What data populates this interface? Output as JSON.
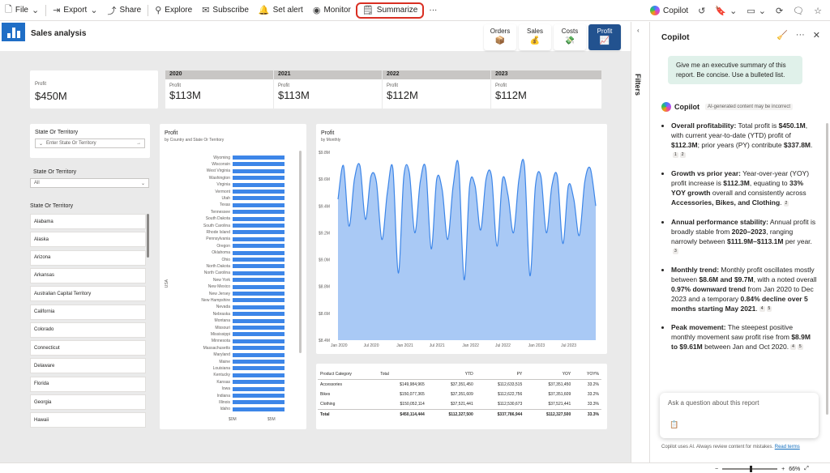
{
  "toolbar": {
    "file": "File",
    "export": "Export",
    "share": "Share",
    "explore": "Explore",
    "subscribe": "Subscribe",
    "set_alert": "Set alert",
    "monitor": "Monitor",
    "summarize": "Summarize",
    "more": "···",
    "copilot": "Copilot"
  },
  "report": {
    "title": "Sales analysis",
    "nav": [
      {
        "label": "Orders",
        "icon": "box-icon"
      },
      {
        "label": "Sales",
        "icon": "money-bag-icon"
      },
      {
        "label": "Costs",
        "icon": "cash-icon"
      },
      {
        "label": "Profit",
        "icon": "chart-up-icon"
      }
    ],
    "kpi": {
      "label": "Profit",
      "value": "$450M"
    },
    "years": [
      {
        "year": "2020",
        "label": "Profit",
        "value": "$113M"
      },
      {
        "year": "2021",
        "label": "Profit",
        "value": "$113M"
      },
      {
        "year": "2022",
        "label": "Profit",
        "value": "$112M"
      },
      {
        "year": "2023",
        "label": "Profit",
        "value": "$112M"
      }
    ],
    "slicer1": {
      "title": "State Or Territory",
      "placeholder": "Enter State Or Territory"
    },
    "slicer2": {
      "title": "State Or Territory",
      "value": "All"
    },
    "slicer3": {
      "title": "State Or Territory",
      "items": [
        "Alabama",
        "Alaska",
        "Arizona",
        "Arkansas",
        "Australian Capital Territory",
        "California",
        "Colorado",
        "Connecticut",
        "Delaware",
        "Florida",
        "Georgia",
        "Hawaii"
      ]
    },
    "bar_chart": {
      "title": "Profit",
      "subtitle": "by Country and State Or Territory",
      "axis_group": "USA",
      "x_ticks": [
        "$0M",
        "$5M"
      ],
      "states": [
        "Wyoming",
        "Wisconsin",
        "West Virginia",
        "Washington",
        "Virginia",
        "Vermont",
        "Utah",
        "Texas",
        "Tennessee",
        "South Dakota",
        "South Carolina",
        "Rhode Island",
        "Pennsylvania",
        "Oregon",
        "Oklahoma",
        "Ohio",
        "North Dakota",
        "North Carolina",
        "New York",
        "New Mexico",
        "New Jersey",
        "New Hampshire",
        "Nevada",
        "Nebraska",
        "Montana",
        "Missouri",
        "Mississippi",
        "Minnesota",
        "Massachusetts",
        "Maryland",
        "Maine",
        "Louisiana",
        "Kentucky",
        "Kansas",
        "Iowa",
        "Indiana",
        "Illinois",
        "Idaho"
      ]
    },
    "line_chart": {
      "title": "Profit",
      "subtitle": "by Monthly",
      "y_ticks": [
        "$9.8M",
        "$9.6M",
        "$9.4M",
        "$9.2M",
        "$9.0M",
        "$8.8M",
        "$8.6M",
        "$8.4M"
      ],
      "x_ticks": [
        "Jan 2020",
        "Jul 2020",
        "Jan 2021",
        "Jul 2021",
        "Jan 2022",
        "Jul 2022",
        "Jan 2023",
        "Jul 2023"
      ]
    },
    "table": {
      "headers": [
        "Product Category",
        "Total",
        "YTD",
        "PY",
        "YOY",
        "YOY%"
      ],
      "rows": [
        [
          "Accessories",
          "$149,984,965",
          "$37,351,450",
          "$112,633,515",
          "$37,351,450",
          "33.2%"
        ],
        [
          "Bikes",
          "$150,077,365",
          "$37,351,609",
          "$112,622,756",
          "$37,351,609",
          "33.2%"
        ],
        [
          "Clothing",
          "$150,052,114",
          "$37,521,441",
          "$112,530,673",
          "$37,521,441",
          "33.3%"
        ]
      ],
      "total": [
        "Total",
        "$450,114,444",
        "$112,327,500",
        "$337,786,944",
        "$112,327,500",
        "33.3%"
      ]
    }
  },
  "filters": {
    "label": "Filters"
  },
  "copilot": {
    "header": "Copilot",
    "user_prompt": "Give me an executive summary of this report. Be concise. Use a bulleted list.",
    "assistant_name": "Copilot",
    "disclaimer": "AI-generated content may be incorrect",
    "input_placeholder": "Ask a question about this report",
    "footer": "Copilot uses AI. Always review content for mistakes.",
    "footer_link": "Read terms"
  },
  "status": {
    "zoom": "66%"
  },
  "chart_data": [
    {
      "type": "bar",
      "title": "Profit",
      "subtitle": "by Country and State Or Territory",
      "categories": [
        "Wyoming",
        "Wisconsin",
        "West Virginia",
        "Washington",
        "Virginia",
        "Vermont",
        "Utah",
        "Texas",
        "Tennessee",
        "South Dakota",
        "South Carolina",
        "Rhode Island",
        "Pennsylvania",
        "Oregon",
        "Oklahoma",
        "Ohio",
        "North Dakota",
        "North Carolina",
        "New York",
        "New Mexico",
        "New Jersey",
        "New Hampshire",
        "Nevada",
        "Nebraska",
        "Montana",
        "Missouri",
        "Mississippi",
        "Minnesota",
        "Massachusetts",
        "Maryland",
        "Maine",
        "Louisiana",
        "Kentucky",
        "Kansas",
        "Iowa",
        "Indiana",
        "Illinois",
        "Idaho"
      ],
      "values": [
        8.9,
        8.9,
        8.9,
        8.9,
        8.9,
        8.9,
        8.9,
        8.9,
        8.9,
        8.9,
        8.9,
        8.9,
        8.9,
        8.9,
        8.9,
        8.9,
        8.9,
        8.9,
        8.9,
        8.9,
        8.9,
        8.9,
        8.9,
        8.9,
        8.9,
        8.9,
        8.9,
        8.9,
        8.9,
        8.9,
        8.9,
        8.9,
        8.9,
        8.9,
        8.9,
        8.9,
        8.9,
        8.9
      ],
      "xlabel": "",
      "ylabel": "USA",
      "xlim": [
        0,
        10
      ]
    },
    {
      "type": "area",
      "title": "Profit",
      "subtitle": "by Monthly",
      "x_start": "Jan 2020",
      "x_end": "Dec 2023",
      "values": [
        9.45,
        9.7,
        9.25,
        9.6,
        9.7,
        9.3,
        9.62,
        9.58,
        9.15,
        9.5,
        9.68,
        8.9,
        9.62,
        9.65,
        9.2,
        9.58,
        9.68,
        9.08,
        9.6,
        9.52,
        9.15,
        9.55,
        9.7,
        8.85,
        9.55,
        9.55,
        9.22,
        9.6,
        9.62,
        9.1,
        9.6,
        9.48,
        9.2,
        9.6,
        9.7,
        8.88,
        9.55,
        9.62,
        9.2,
        9.55,
        9.62,
        9.12,
        9.55,
        9.45,
        9.18,
        9.58,
        9.68,
        9.4
      ],
      "ylim": [
        8.4,
        9.8
      ]
    }
  ]
}
